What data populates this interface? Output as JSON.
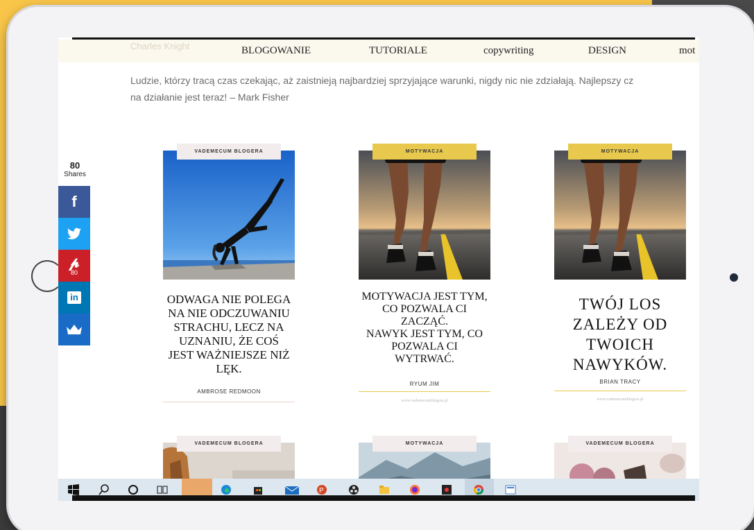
{
  "nav": {
    "ghost": "Charles Knight",
    "items": [
      "BLOGOWANIE",
      "TUTORIALE",
      "copywriting",
      "DESIGN",
      "mot"
    ]
  },
  "quote": {
    "line1": "Ludzie, którzy tracą czas czekając, aż zaistnieją najbardziej sprzyjające warunki, nigdy nic nie zdziałają. Najlepszy cz",
    "line2": "na działanie jest teraz! – Mark Fisher"
  },
  "share": {
    "count": "80",
    "count_label": "Shares",
    "pinterest_count": "80",
    "buttons": [
      {
        "name": "facebook",
        "glyph": "f",
        "color": "#3b5998"
      },
      {
        "name": "twitter",
        "glyph": "t",
        "color": "#1da1f2"
      },
      {
        "name": "pinterest",
        "glyph": "P",
        "color": "#cb2027"
      },
      {
        "name": "linkedin",
        "glyph": "in",
        "color": "#0077b5"
      },
      {
        "name": "crown",
        "glyph": "♛",
        "color": "#1a6bc6"
      }
    ]
  },
  "cards": [
    {
      "tag": "VADEMECUM BLOGERA",
      "title_lines": [
        "ODWAGA NIE POLEGA",
        "NA NIE ODCZUWANIU",
        "STRACHU, LECZ NA",
        "UZNANIU, ŻE COŚ",
        "JEST WAŻNIEJSZE NIŻ",
        "LĘK."
      ],
      "author": "AMBROSE REDMOON",
      "url": ""
    },
    {
      "tag": "MOTYWACJA",
      "title_lines": [
        "MOTYWACJA JEST TYM,",
        "CO POZWALA CI",
        "ZACZĄĆ.",
        "NAWYK JEST TYM, CO",
        "POZWALA CI",
        "WYTRWAĆ."
      ],
      "author": "RYUM JIM",
      "url": "www.vademecumblogera.pl"
    },
    {
      "tag": "MOTYWACJA",
      "title_lines": [
        "TWÓJ LOS",
        "ZALEŻY OD",
        "TWOICH",
        "NAWYKÓW."
      ],
      "author": "BRIAN TRACY",
      "url": "www.vademecumblogera.pl"
    }
  ],
  "cards_row2": [
    {
      "tag": "VADEMECUM BLOGERA"
    },
    {
      "tag": "MOTYWACJA"
    },
    {
      "tag": "VADEMECUM BLOGERA"
    }
  ],
  "taskbar": {
    "icons": [
      "windows-start",
      "search",
      "cortana",
      "task-view",
      "app-orange",
      "edge",
      "store",
      "mail",
      "powerpoint",
      "obs",
      "file-explorer",
      "firefox",
      "media-app",
      "chrome",
      "photos"
    ]
  }
}
